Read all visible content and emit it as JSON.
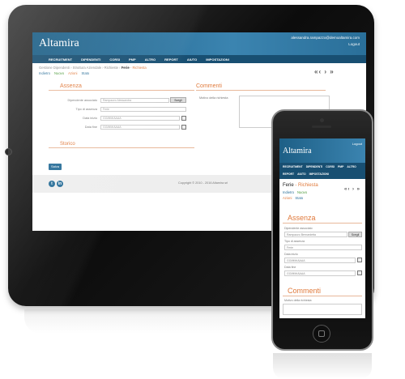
{
  "app_title": "Altamira",
  "tablet": {
    "user": "alessandra.rampazzo@demoaltamira.com",
    "logout": "Logout",
    "nav": [
      "RECRUITMENT",
      "DIPENDENTI",
      "CORSI",
      "PMP",
      "ALTRO",
      "REPORT",
      "AIUTO",
      "IMPOSTAZIONI"
    ],
    "breadcrumb_prefix": "Gestione Dipendenti › Struttura Aziendale › Richieste ›",
    "breadcrumb_current": "Ferie",
    "breadcrumb_suffix": "- Richiesta",
    "subnav": {
      "indietro": "Indietro",
      "nuovo": "Nuovo",
      "azioni": "Azioni",
      "stato": "Stato"
    },
    "pager": "«‹ › »",
    "section_assenza": "Assenza",
    "section_commenti": "Commenti",
    "section_storico": "Storico",
    "fields": {
      "dipendente_label": "Dipendente associato",
      "dipendente_value": "Rampazzo Alessandra",
      "scegli_button": "Scegli",
      "tipo_label": "Tipo di assenza",
      "tipo_value": "Ferie",
      "data_inizio_label": "Data inizio",
      "data_inizio_placeholder": "GG/MM/AAAA",
      "data_fine_label": "Data fine",
      "data_fine_placeholder": "GG/MM/AAAA",
      "note_label": "Motivo della richiesta"
    },
    "save_button": "Salva",
    "copyright": "Copyright © 2010 - 2016 Altamira srl"
  },
  "phone": {
    "logout": "Logout",
    "nav_row1": [
      "RECRUITMENT",
      "DIPENDENTI",
      "CORSI",
      "PMP",
      "ALTRO"
    ],
    "nav_row2": [
      "REPORT",
      "AIUTO",
      "IMPOSTAZIONI"
    ],
    "title_current": "Ferie",
    "title_suffix": "- Richiesta",
    "subnav": {
      "indietro": "Indietro",
      "nuovo": "Nuovo",
      "azioni": "Azioni",
      "stato": "Stato"
    },
    "pager": "«‹ › »",
    "section_assenza": "Assenza",
    "section_commenti": "Commenti",
    "fields": {
      "dipendente_label": "Dipendente associato",
      "dipendente_value": "Rampazzo Bernardetta",
      "scegli_button": "Scegli",
      "tipo_label": "Tipo di assenza",
      "tipo_value": "Ferie",
      "data_inizio_label": "Data inizio",
      "data_inizio_placeholder": "GG/MM/AAAA",
      "data_fine_label": "Data fine",
      "data_fine_placeholder": "GG/MM/AAAA",
      "note_label": "Motivo della richiesta"
    }
  },
  "colors": {
    "header": "#2a6f99",
    "accent": "#e07a3c",
    "nav": "#184f72"
  },
  "icons": {
    "calendar": "calendar-icon",
    "twitter": "twitter-icon",
    "linkedin": "linkedin-icon"
  }
}
